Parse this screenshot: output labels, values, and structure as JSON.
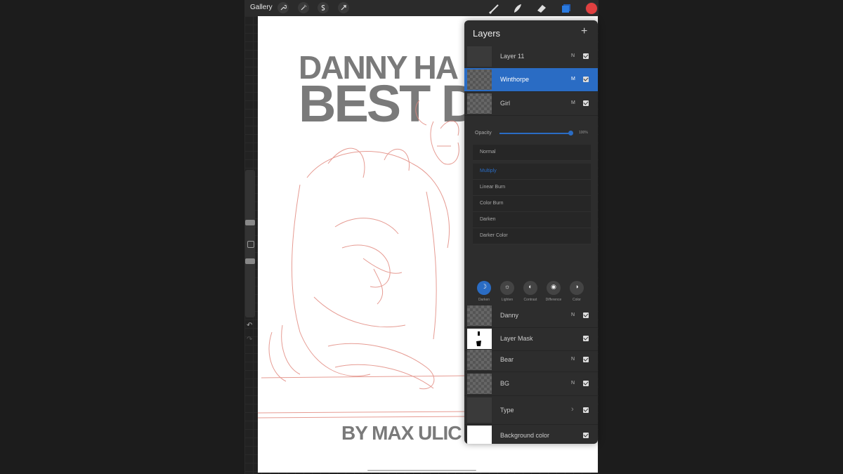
{
  "toolbar": {
    "gallery_label": "Gallery",
    "left_tools": [
      "wrench-icon",
      "magic-wand-icon",
      "selection-icon",
      "transform-icon"
    ],
    "right_tools": [
      "brush-icon",
      "smudge-icon",
      "eraser-icon",
      "layers-icon"
    ],
    "current_color": "#e04040"
  },
  "canvas": {
    "title_line1": "DANNY HA",
    "title_line2": "BEST D",
    "byline": "BY MAX ULIC"
  },
  "layers_panel": {
    "title": "Layers",
    "add_label": "+",
    "top_layers": [
      {
        "name": "Layer 11",
        "blend": "N",
        "visible": true,
        "selected": false
      },
      {
        "name": "Winthorpe",
        "blend": "M",
        "visible": true,
        "selected": true
      },
      {
        "name": "Girl",
        "blend": "M",
        "visible": true,
        "selected": false
      }
    ],
    "opacity": {
      "label": "Opacity",
      "value_text": "100%",
      "value": 100
    },
    "blend_modes": [
      "Normal",
      "Multiply",
      "Linear Burn",
      "Color Burn",
      "Darken",
      "Darker Color"
    ],
    "active_blend": "Multiply",
    "mode_categories": [
      {
        "label": "Darken",
        "icon": "moon-icon",
        "active": true
      },
      {
        "label": "Lighten",
        "icon": "sun-icon",
        "active": false
      },
      {
        "label": "Contrast",
        "icon": "contrast-icon",
        "active": false
      },
      {
        "label": "Difference",
        "icon": "difference-icon",
        "active": false
      },
      {
        "label": "Color",
        "icon": "color-icon",
        "active": false
      }
    ],
    "bottom_layers": [
      {
        "name": "Danny",
        "blend": "N",
        "visible": true
      },
      {
        "name": "Layer Mask",
        "blend": "",
        "visible": true
      },
      {
        "name": "Bear",
        "blend": "N",
        "visible": true
      },
      {
        "name": "BG",
        "blend": "N",
        "visible": true
      },
      {
        "name": "Type",
        "blend": "",
        "visible": true
      },
      {
        "name": "Background color",
        "blend": "",
        "visible": true
      }
    ]
  }
}
